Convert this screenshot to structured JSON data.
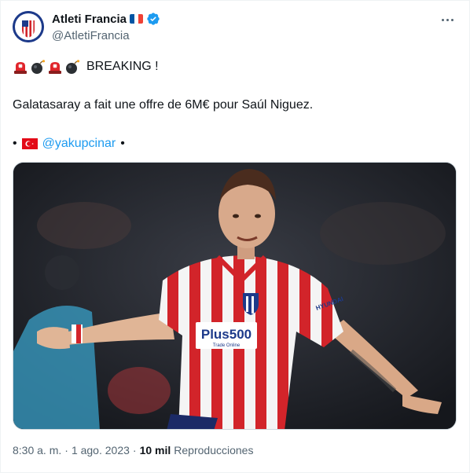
{
  "author": {
    "display_name": "Atleti Francia",
    "handle": "@AtletiFrancia",
    "badge_icon": "verified-badge-icon",
    "name_flag": "france-flag-icon"
  },
  "menu": {
    "icon": "more-options-icon"
  },
  "tweet": {
    "line1_emojis": [
      "rotating-light-icon",
      "bomb-icon",
      "rotating-light-icon",
      "bomb-icon"
    ],
    "line1_text": "BREAKING !",
    "line2_text": "Galatasaray a fait une offre de 6M€ pour Saúl Niguez.",
    "line3_prefix": "•",
    "line3_flag": "turkey-flag-icon",
    "line3_mention": "@yakupcinar",
    "line3_suffix": "•"
  },
  "media": {
    "sponsor_text": "Plus500",
    "sponsor_sub": "Trade Online",
    "sleeve_text": "HYUNDAI"
  },
  "meta": {
    "time": "8:30 a. m.",
    "separator": "·",
    "date": "1 ago. 2023",
    "separator2": "·",
    "views_count": "10 mil",
    "views_label": "Reproducciones"
  },
  "colors": {
    "link": "#1d9bf0",
    "secondary_text": "#536471",
    "verified": "#1d9bf0",
    "atletico_red": "#d2242a"
  }
}
